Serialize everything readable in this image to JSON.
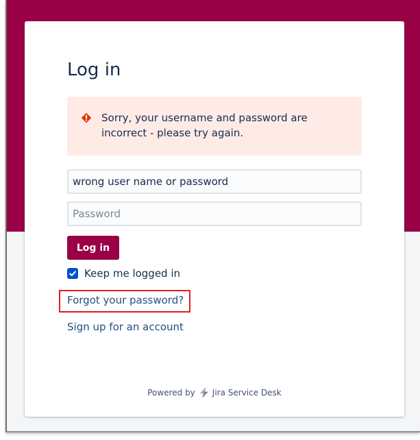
{
  "login": {
    "title": "Log in",
    "error_message": "Sorry, your username and password are incorrect - please try again.",
    "username_value": "wrong user name or password",
    "password_placeholder": "Password",
    "submit_label": "Log in",
    "keep_logged_in_label": "Keep me logged in",
    "keep_logged_in_checked": true,
    "forgot_password_link": "Forgot your password?",
    "signup_link": "Sign up for an account"
  },
  "footer": {
    "powered_by_prefix": "Powered by",
    "product_name": "Jira Service Desk",
    "logo_icon": "jira-service-desk-bolt-icon"
  },
  "icons": {
    "error": "error-diamond-icon",
    "checkbox": "checkmark-icon"
  },
  "colors": {
    "brand_banner": "#9a0046",
    "login_button": "#9a0046",
    "error_background": "#ffebe6",
    "error_icon": "#de350b",
    "link": "#205081",
    "checkbox": "#0052cc",
    "highlight_box": "#e31c1c"
  }
}
